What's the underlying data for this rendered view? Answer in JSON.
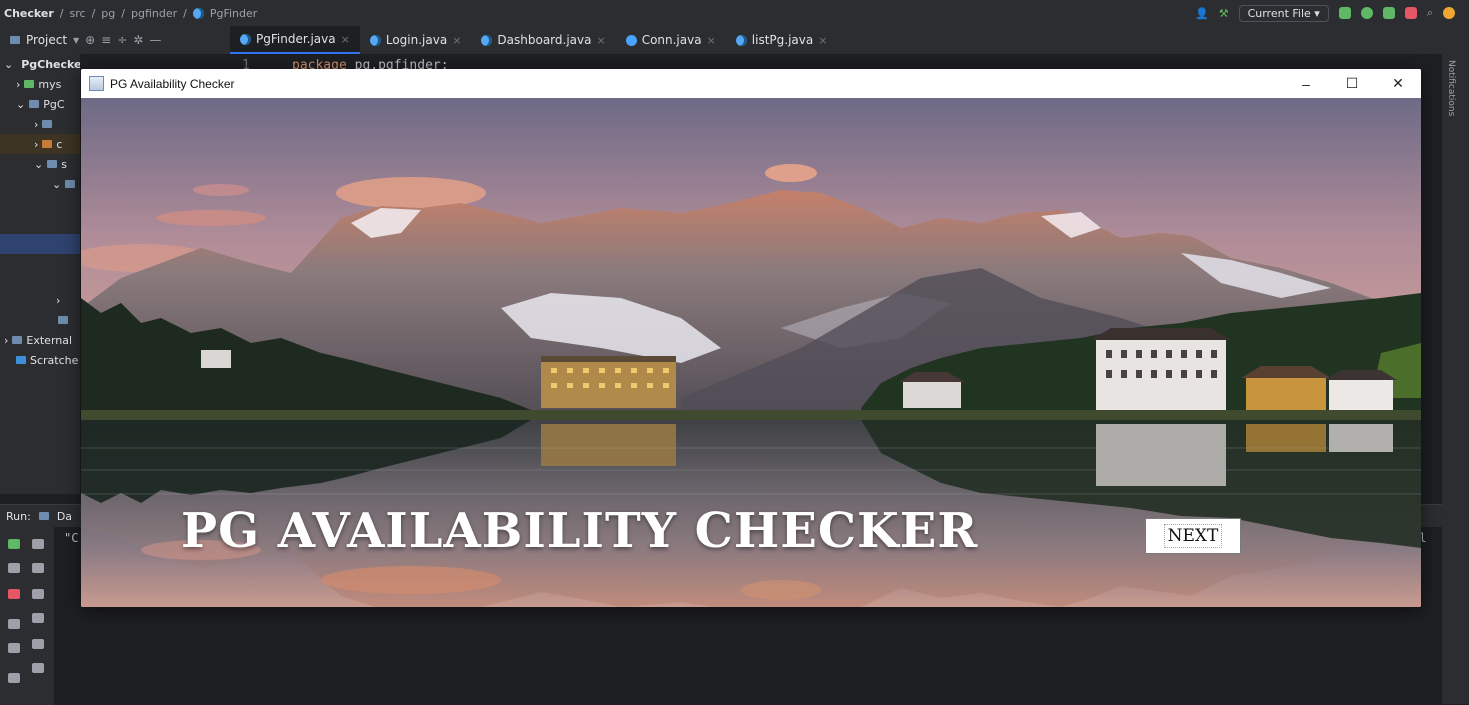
{
  "ide": {
    "breadcrumbs": [
      "Checker",
      "src",
      "pg",
      "pgfinder",
      "PgFinder"
    ],
    "run_config": "Current File",
    "project_label": "Project",
    "tabs": [
      {
        "label": "PgFinder.java",
        "active": true
      },
      {
        "label": "Login.java",
        "active": false
      },
      {
        "label": "Dashboard.java",
        "active": false
      },
      {
        "label": "Conn.java",
        "active": false
      },
      {
        "label": "listPg.java",
        "active": false
      }
    ],
    "tree": [
      {
        "label": "PgChecker"
      },
      {
        "label": "mys"
      },
      {
        "label": "PgC"
      },
      {
        "label": ""
      },
      {
        "label": "c"
      },
      {
        "label": "s"
      },
      {
        "label": ""
      },
      {
        "label": "External"
      },
      {
        "label": "Scratche"
      }
    ],
    "editor": {
      "line_number": "1",
      "keyword": "package",
      "code": "pg.pgfinder;"
    },
    "run_pane": {
      "title": "Run:",
      "tab": "Da",
      "output_left": "\"C",
      "output_right": "el"
    },
    "notifications_label": "Notifications"
  },
  "window": {
    "title": "PG Availability Checker",
    "minimize": "–",
    "maximize": "☐",
    "close": "✕"
  },
  "app": {
    "heading": "PG AVAILABILITY CHECKER",
    "next_label": "NEXT"
  },
  "colors": {
    "ide_bg": "#1e1f22",
    "ide_panel": "#2b2d30",
    "accent": "#3574f0"
  }
}
